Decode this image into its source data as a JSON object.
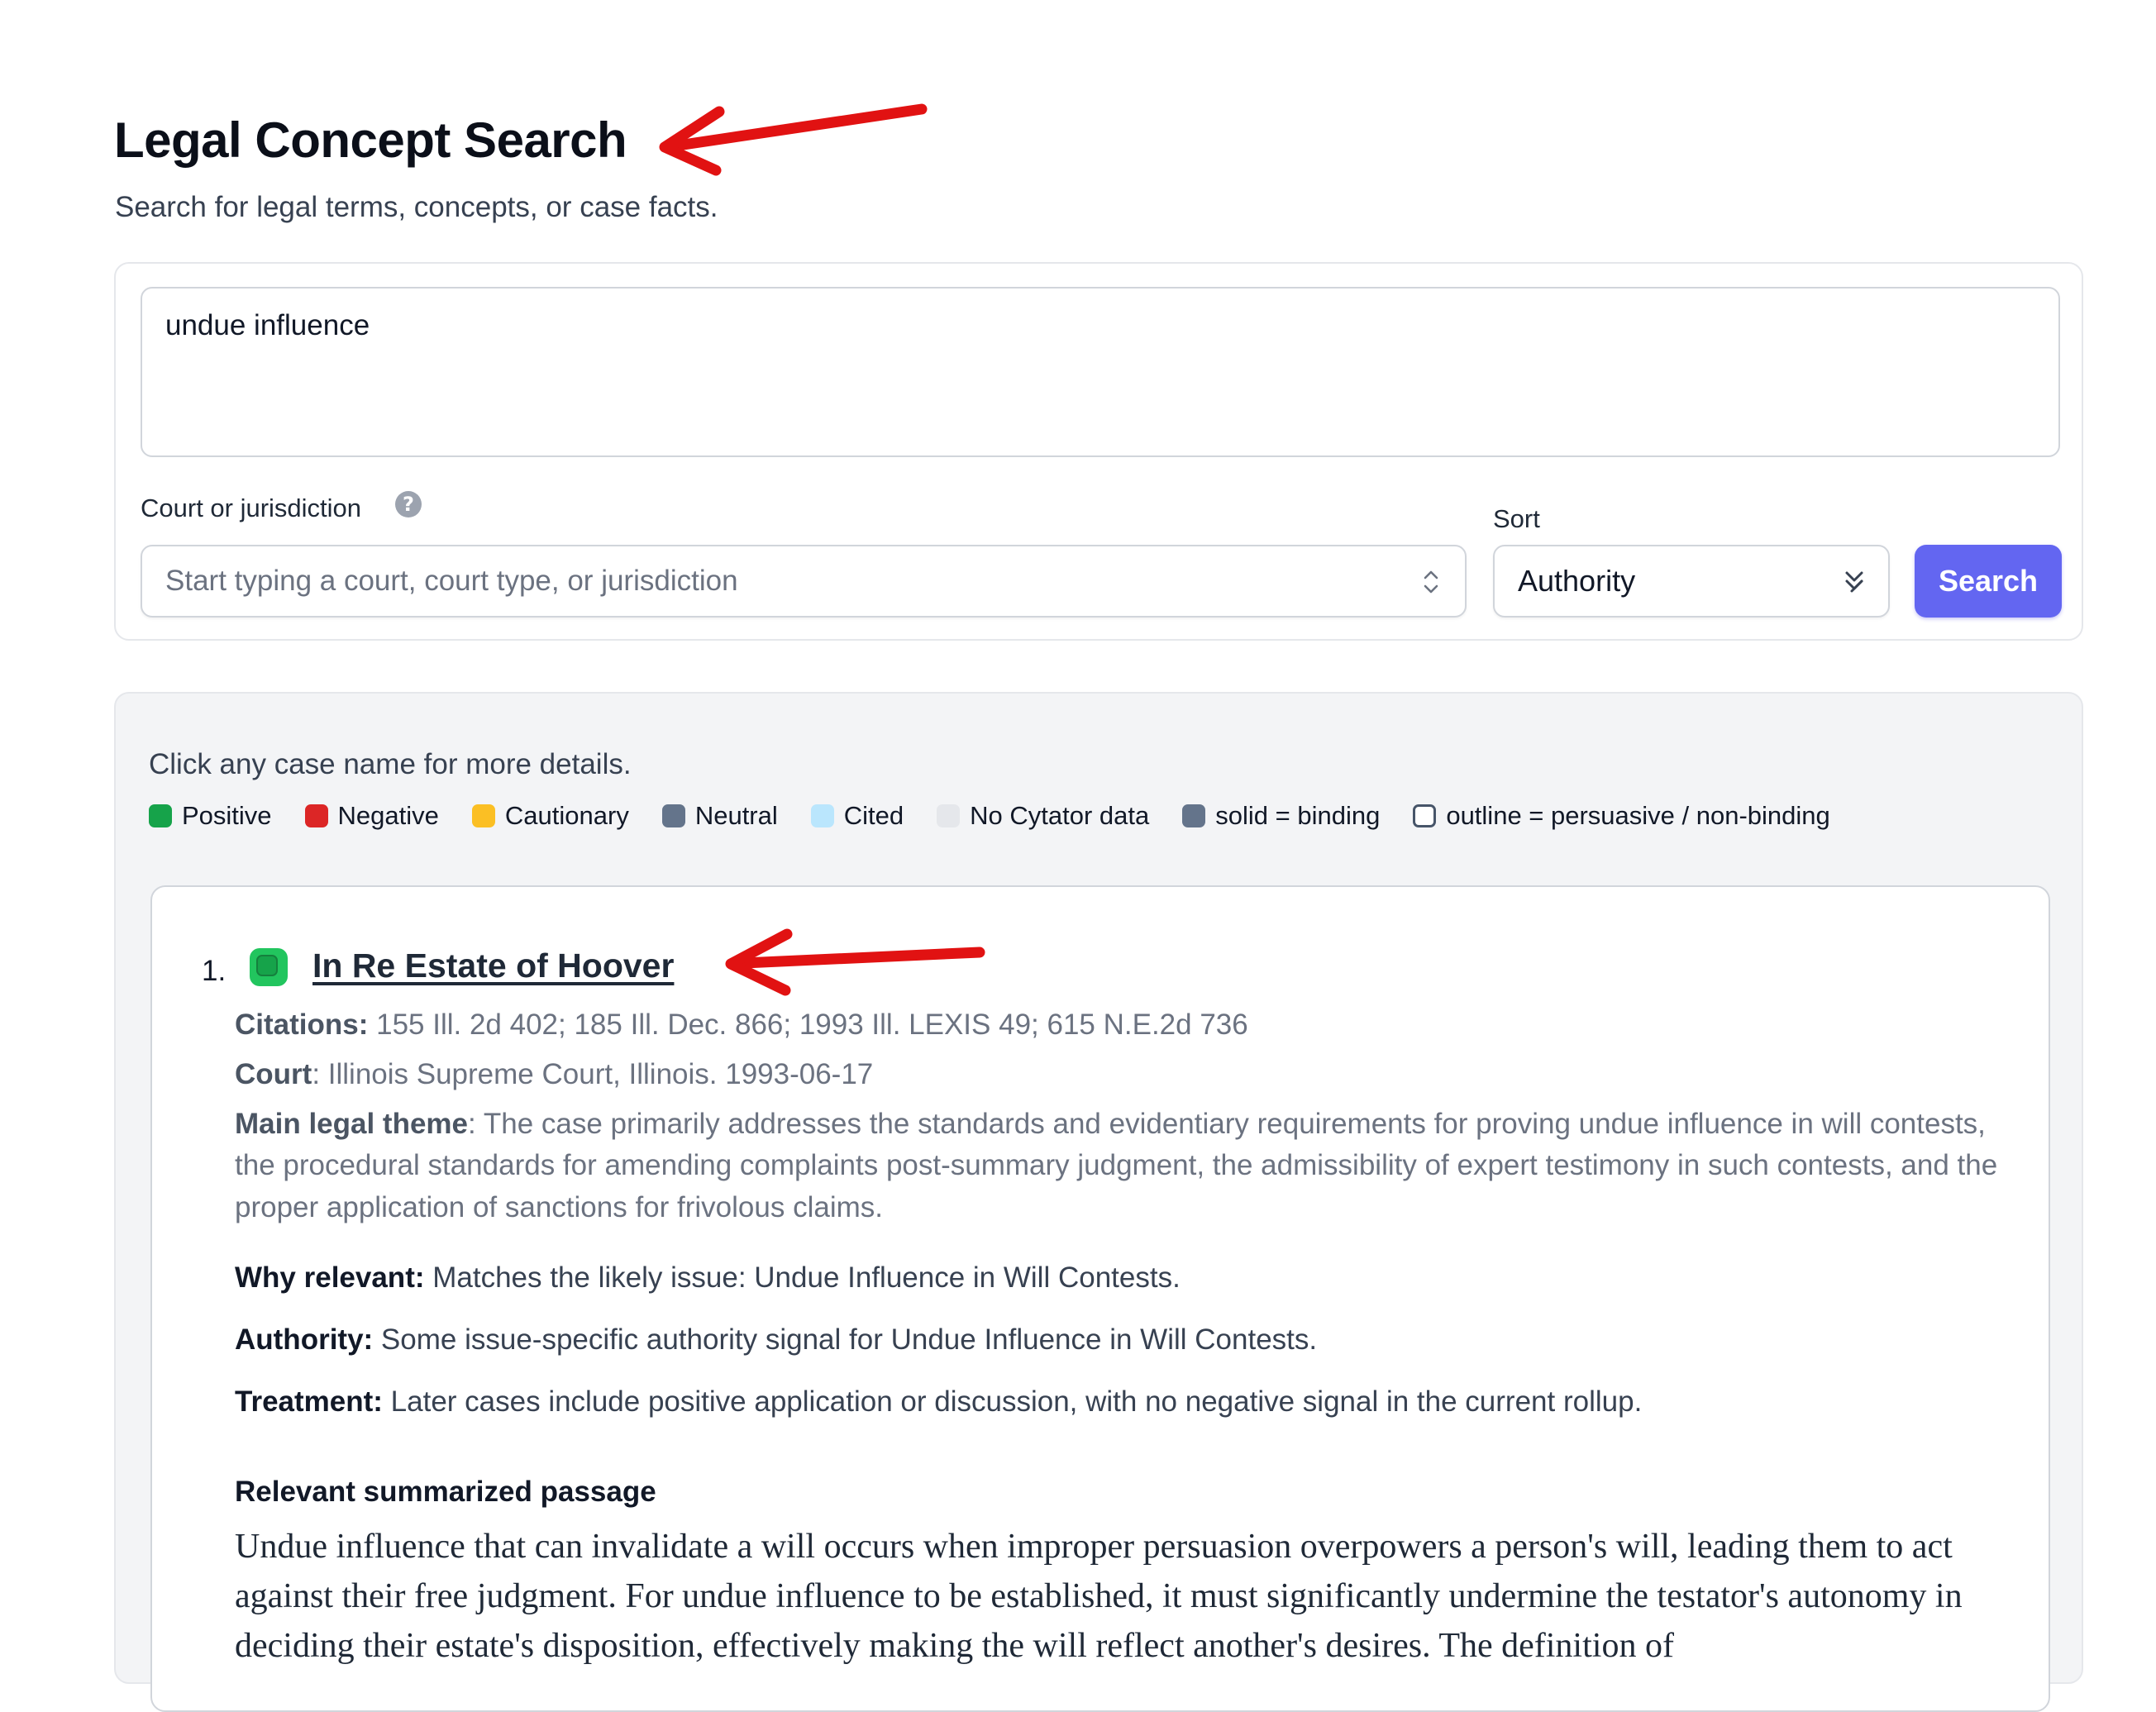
{
  "header": {
    "title": "Legal Concept Search",
    "subtitle": "Search for legal terms, concepts, or case facts."
  },
  "search": {
    "query": "undue influence",
    "court_label": "Court or jurisdiction",
    "court_placeholder": "Start typing a court, court type, or jurisdiction",
    "sort_label": "Sort",
    "sort_value": "Authority",
    "button_label": "Search"
  },
  "results": {
    "hint": "Click any case name for more details.",
    "legend": [
      {
        "label": "Positive",
        "color": "#16a34a",
        "style": "solid"
      },
      {
        "label": "Negative",
        "color": "#dc2626",
        "style": "solid"
      },
      {
        "label": "Cautionary",
        "color": "#fbbf24",
        "style": "solid"
      },
      {
        "label": "Neutral",
        "color": "#64748b",
        "style": "solid"
      },
      {
        "label": "Cited",
        "color": "#bae6fd",
        "style": "solid"
      },
      {
        "label": "No Cytator data",
        "color": "#e5e7eb",
        "style": "solid"
      },
      {
        "label": "solid = binding",
        "color": "#64748b",
        "style": "solid"
      },
      {
        "label": "outline = persuasive / non-binding",
        "color": "#475569",
        "style": "outline"
      }
    ],
    "items": [
      {
        "number": "1.",
        "status": "positive",
        "status_color": "#16a34a",
        "case_name": "In Re Estate of Hoover",
        "citations_label": "Citations:",
        "citations": "155 Ill. 2d 402; 185 Ill. Dec. 866; 1993 Ill. LEXIS 49; 615 N.E.2d 736",
        "court_label": "Court",
        "court": ": Illinois Supreme Court, Illinois. 1993-06-17",
        "theme_label": "Main legal theme",
        "theme": ": The case primarily addresses the standards and evidentiary requirements for proving undue influence in will contests, the procedural standards for amending complaints post-summary judgment, the admissibility of expert testimony in such contests, and the proper application of sanctions for frivolous claims.",
        "why_label": "Why relevant:",
        "why": " Matches the likely issue: Undue Influence in Will Contests.",
        "authority_label": "Authority:",
        "authority": " Some issue-specific authority signal for Undue Influence in Will Contests.",
        "treatment_label": "Treatment:",
        "treatment": " Later cases include positive application or discussion, with no negative signal in the current rollup.",
        "passage_heading": "Relevant summarized passage",
        "passage": "Undue influence that can invalidate a will occurs when improper persuasion overpowers a person's will, leading them to act against their free judgment. For undue influence to be established, it must significantly undermine the testator's autonomy in deciding their estate's disposition, effectively making the will reflect another's desires. The definition of"
      }
    ]
  },
  "annotations": {
    "arrow_color": "#e11212"
  }
}
